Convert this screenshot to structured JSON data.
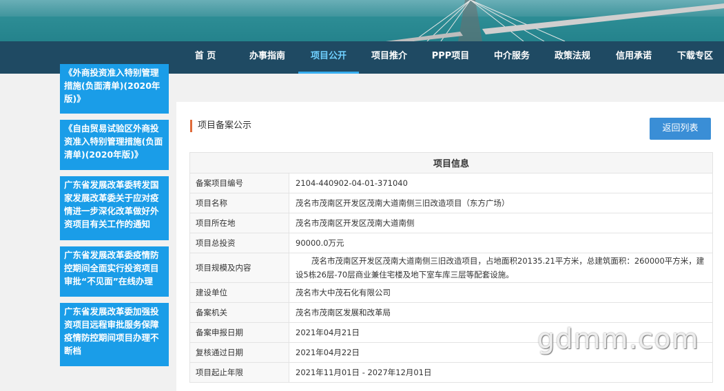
{
  "nav": {
    "items": [
      {
        "label": "首 页"
      },
      {
        "label": "办事指南"
      },
      {
        "label": "项目公开"
      },
      {
        "label": "项目推介"
      },
      {
        "label": "PPP项目"
      },
      {
        "label": "中介服务"
      },
      {
        "label": "政策法规"
      },
      {
        "label": "信用承诺"
      },
      {
        "label": "下载专区"
      }
    ],
    "active_index": 2
  },
  "sidebar": {
    "links": [
      {
        "label": "《外商投资准入特别管理措施(负面清单)(2020年版)》"
      },
      {
        "label": "《自由贸易试验区外商投资准入特别管理措施(负面清单)(2020年版)》"
      },
      {
        "label": "广东省发展改革委转发国家发展改革委关于应对疫情进一步深化改革做好外资项目有关工作的通知"
      },
      {
        "label": "广东省发展改革委疫情防控期间全面实行投资项目审批“不见面”在线办理"
      },
      {
        "label": "广东省发展改革委加强投资项目远程审批服务保障疫情防控期间项目办理不断档"
      }
    ]
  },
  "main": {
    "section_title": "项目备案公示",
    "back_button": "返回列表",
    "table_header": "项目信息",
    "rows": [
      {
        "label": "备案项目编号",
        "value": "2104-440902-04-01-371040"
      },
      {
        "label": "项目名称",
        "value": "茂名市茂南区开发区茂南大道南侧三旧改造项目（东方广场）"
      },
      {
        "label": "项目所在地",
        "value": "茂名市茂南区开发区茂南大道南侧"
      },
      {
        "label": "项目总投资",
        "value": "90000.0万元"
      },
      {
        "label": "项目规模及内容",
        "value": "茂名市茂南区开发区茂南大道南侧三旧改造项目，占地面积20135.21平方米，总建筑面积：260000平方米，建设5栋26层-70层商业兼住宅楼及地下室车库三层等配套设施。"
      },
      {
        "label": "建设单位",
        "value": "茂名市大中茂石化有限公司"
      },
      {
        "label": "备案机关",
        "value": "茂名市茂南区发展和改革局"
      },
      {
        "label": "备案申报日期",
        "value": "2021年04月21日"
      },
      {
        "label": "复核通过日期",
        "value": "2021年04月22日"
      },
      {
        "label": "项目起止年限",
        "value": "2021年11月01日 - 2027年12月01日"
      }
    ]
  },
  "watermark": "gdmm.com"
}
